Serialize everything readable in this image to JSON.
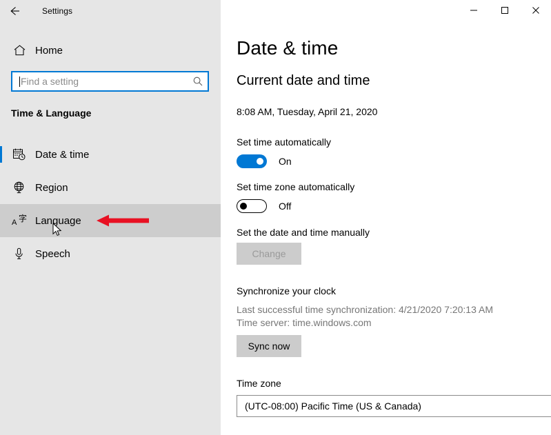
{
  "titlebar": {
    "app_title": "Settings",
    "back_icon": "back-arrow-icon",
    "minimize_label": "–",
    "maximize_label": "□",
    "close_label": "✕"
  },
  "sidebar": {
    "home": {
      "label": "Home",
      "icon": "home-icon"
    },
    "search": {
      "placeholder": "Find a setting",
      "value": "",
      "icon": "search-icon"
    },
    "section_title": "Time & Language",
    "items": [
      {
        "label": "Date & time",
        "icon": "calendar-clock-icon",
        "selected": true,
        "hovered": false
      },
      {
        "label": "Region",
        "icon": "globe-icon",
        "selected": false,
        "hovered": false
      },
      {
        "label": "Language",
        "icon": "language-icon",
        "selected": false,
        "hovered": true
      },
      {
        "label": "Speech",
        "icon": "microphone-icon",
        "selected": false,
        "hovered": false
      }
    ]
  },
  "annotation": {
    "arrow_color": "#e81123",
    "points_to": "Language",
    "cursor_icon": "mouse-pointer-icon"
  },
  "main": {
    "page_title": "Date & time",
    "group_title": "Current date and time",
    "current_datetime": "8:08 AM, Tuesday, April 21, 2020",
    "set_time_automatically": {
      "label": "Set time automatically",
      "state_text": "On",
      "on": true
    },
    "set_timezone_automatically": {
      "label": "Set time zone automatically",
      "state_text": "Off",
      "on": false
    },
    "set_manually": {
      "label": "Set the date and time manually",
      "button_label": "Change",
      "button_disabled": true
    },
    "synchronize": {
      "title": "Synchronize your clock",
      "last_sync": "Last successful time synchronization: 4/21/2020 7:20:13 AM",
      "time_server": "Time server: time.windows.com",
      "button_label": "Sync now",
      "button_disabled": false
    },
    "timezone": {
      "label": "Time zone",
      "selected": "(UTC-08:00) Pacific Time (US & Canada)",
      "chevron_icon": "chevron-down-icon"
    }
  },
  "colors": {
    "accent": "#0078d4",
    "sidebar_bg": "#e6e6e6",
    "hover_bg": "#cdcdcd",
    "button_bg": "#cccccc",
    "muted_text": "#767676",
    "annotation_red": "#e81123"
  }
}
